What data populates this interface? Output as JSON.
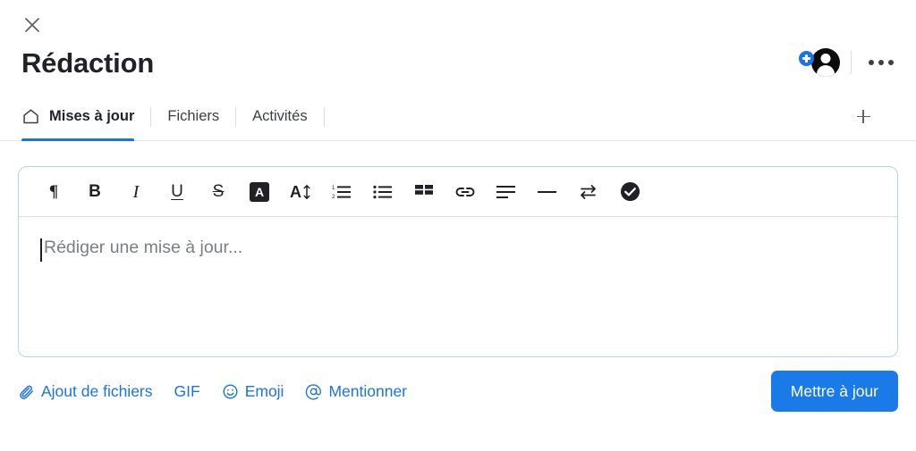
{
  "header": {
    "close_icon": "close-icon",
    "title": "Rédaction",
    "avatar_icon": "avatar-person-icon",
    "avatar_badge_icon": "add-person-plus-icon",
    "more_icon": "more-options-icon"
  },
  "tabs": [
    {
      "label": "Mises à jour",
      "icon": "home-icon",
      "active": true
    },
    {
      "label": "Fichiers",
      "icon": "",
      "active": false
    },
    {
      "label": "Activités",
      "icon": "",
      "active": false
    }
  ],
  "add_tab": {
    "icon": "plus-icon",
    "label": "+"
  },
  "toolbar": [
    {
      "name": "paragraph-format-icon",
      "glyph": "¶"
    },
    {
      "name": "bold-icon",
      "glyph": "B"
    },
    {
      "name": "italic-icon",
      "glyph": "I"
    },
    {
      "name": "underline-icon",
      "glyph": "U"
    },
    {
      "name": "strikethrough-icon",
      "glyph": "S"
    },
    {
      "name": "text-highlight-icon",
      "glyph": "A"
    },
    {
      "name": "font-size-icon",
      "glyph": "A"
    },
    {
      "name": "ordered-list-icon",
      "glyph": ""
    },
    {
      "name": "bulleted-list-icon",
      "glyph": ""
    },
    {
      "name": "table-icon",
      "glyph": ""
    },
    {
      "name": "link-icon",
      "glyph": ""
    },
    {
      "name": "align-text-icon",
      "glyph": ""
    },
    {
      "name": "horizontal-rule-icon",
      "glyph": ""
    },
    {
      "name": "swap-arrows-icon",
      "glyph": ""
    },
    {
      "name": "check-circle-icon",
      "glyph": ""
    }
  ],
  "editor": {
    "placeholder": "Rédiger une mise à jour...",
    "value": ""
  },
  "footer": {
    "actions": [
      {
        "label": "Ajout de fichiers",
        "icon": "paperclip-icon"
      },
      {
        "label": "GIF",
        "icon": ""
      },
      {
        "label": "Emoji",
        "icon": "smiley-icon"
      },
      {
        "label": "Mentionner",
        "icon": "at-sign-icon"
      }
    ],
    "submit_label": "Mettre à jour"
  },
  "colors": {
    "accent_blue": "#1a73e8",
    "button_blue": "#1a7ae8",
    "editor_border": "#b6d4e8",
    "text_dark": "#1f2328",
    "placeholder_grey": "#7a7f86"
  }
}
